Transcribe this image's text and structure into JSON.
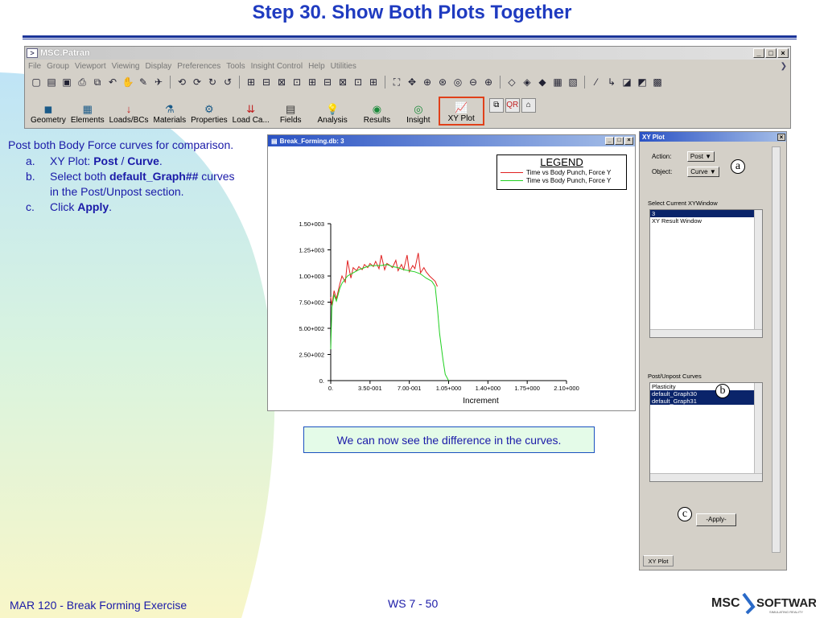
{
  "slide": {
    "title": "Step 30. Show Both Plots Together",
    "footer_left": "MAR 120 - Break Forming Exercise",
    "footer_mid": "WS 7 - 50",
    "brand_name_left": "MSC",
    "brand_name_right": "SOFTWARE",
    "brand_tagline": "SIMULATING REALITY"
  },
  "instructions": {
    "intro": "Post both Body Force curves for comparison.",
    "steps": [
      {
        "letter": "a.",
        "pre": "XY Plot: ",
        "b1": "Post",
        "mid": " / ",
        "b2": "Curve",
        "post": "."
      },
      {
        "letter": "b.",
        "pre": "Select both ",
        "b1": "default_Graph##",
        "mid": "",
        "b2": "",
        "post": " curves in the Post/Unpost section."
      },
      {
        "letter": "c.",
        "pre": "Click ",
        "b1": "Apply",
        "mid": "",
        "b2": "",
        "post": "."
      }
    ]
  },
  "patran": {
    "window_title": "MSC.Patran",
    "menu": [
      "File",
      "Group",
      "Viewport",
      "Viewing",
      "Display",
      "Preferences",
      "Tools",
      "Insight Control",
      "Help",
      "Utilities"
    ],
    "app_buttons": [
      {
        "label": "Geometry",
        "icon": "cube-icon"
      },
      {
        "label": "Elements",
        "icon": "mesh-icon"
      },
      {
        "label": "Loads/BCs",
        "icon": "load-arrow-icon"
      },
      {
        "label": "Materials",
        "icon": "materials-icon"
      },
      {
        "label": "Properties",
        "icon": "properties-icon"
      },
      {
        "label": "Load Ca...",
        "icon": "load-case-icon"
      },
      {
        "label": "Fields",
        "icon": "table-icon"
      },
      {
        "label": "Analysis",
        "icon": "bulb-icon"
      },
      {
        "label": "Results",
        "icon": "results-icon"
      },
      {
        "label": "Insight",
        "icon": "insight-icon"
      },
      {
        "label": "XY Plot",
        "icon": "xy-plot-icon"
      }
    ]
  },
  "plot_window": {
    "title": "Break_Forming.db: 3",
    "legend_title": "LEGEND",
    "legend": [
      {
        "label": "Time vs Body Punch, Force Y",
        "color": "#e02020"
      },
      {
        "label": "Time vs Body Punch, Force Y",
        "color": "#20d020"
      }
    ]
  },
  "chart_data": {
    "type": "line",
    "xlabel": "Increment",
    "ylabel": "",
    "x_ticks": [
      "0.",
      "3.50-001",
      "7.00-001",
      "1.05+000",
      "1.40+000",
      "1.75+000",
      "2.10+000"
    ],
    "y_ticks": [
      "0.",
      "2.50+002",
      "5.00+002",
      "7.50+002",
      "1.00+003",
      "1.25+003",
      "1.50+003"
    ],
    "xlim": [
      0,
      2.1
    ],
    "ylim": [
      0,
      1500
    ],
    "series": [
      {
        "name": "Time vs Body Punch, Force Y",
        "color": "#e02020",
        "x": [
          0,
          0.01,
          0.03,
          0.05,
          0.08,
          0.1,
          0.13,
          0.15,
          0.18,
          0.2,
          0.23,
          0.25,
          0.28,
          0.3,
          0.33,
          0.35,
          0.38,
          0.4,
          0.43,
          0.45,
          0.48,
          0.5,
          0.53,
          0.55,
          0.58,
          0.6,
          0.63,
          0.65,
          0.68,
          0.7,
          0.73,
          0.75,
          0.78,
          0.8,
          0.83,
          0.85,
          0.88,
          0.9,
          0.93,
          0.95
        ],
        "y": [
          800,
          720,
          860,
          780,
          920,
          1000,
          940,
          1150,
          980,
          1080,
          1050,
          1090,
          1060,
          1110,
          1080,
          1120,
          1090,
          1140,
          1070,
          1200,
          1060,
          1120,
          1100,
          1080,
          1150,
          1050,
          1110,
          1060,
          1200,
          1040,
          1100,
          1070,
          1220,
          1030,
          1080,
          1040,
          1000,
          980,
          950,
          900
        ]
      },
      {
        "name": "Time vs Body Punch, Force Y",
        "color": "#20d020",
        "x": [
          0,
          0.01,
          0.03,
          0.05,
          0.08,
          0.1,
          0.15,
          0.2,
          0.25,
          0.3,
          0.35,
          0.4,
          0.45,
          0.5,
          0.55,
          0.6,
          0.65,
          0.7,
          0.75,
          0.8,
          0.85,
          0.9,
          0.93,
          0.95,
          0.97,
          1.0,
          1.02,
          1.05
        ],
        "y": [
          300,
          700,
          820,
          760,
          880,
          930,
          1000,
          1030,
          1060,
          1080,
          1100,
          1100,
          1100,
          1110,
          1090,
          1080,
          1060,
          1050,
          1040,
          1020,
          980,
          950,
          900,
          700,
          450,
          200,
          60,
          0
        ]
      }
    ]
  },
  "xy_panel": {
    "title": "XY Plot",
    "action_label": "Action:",
    "action_value": "Post",
    "object_label": "Object:",
    "object_value": "Curve",
    "window_section": "Select Current XYWindow",
    "windows": [
      "3",
      "XY Result Window"
    ],
    "selected_window": 0,
    "postunpost_section": "Post/Unpost Curves",
    "curves": [
      "Plasticity",
      "default_Graph30",
      "default_Graph31"
    ],
    "selected_curves": [
      1,
      2
    ],
    "apply_label": "-Apply-",
    "tab_label": "XY Plot",
    "callouts": [
      "a",
      "b",
      "c"
    ]
  },
  "note": "We can now see the difference in the curves.",
  "colors": {
    "title": "#1f3bc0",
    "text": "#1a1aa8",
    "highlight": "#e0401a"
  }
}
